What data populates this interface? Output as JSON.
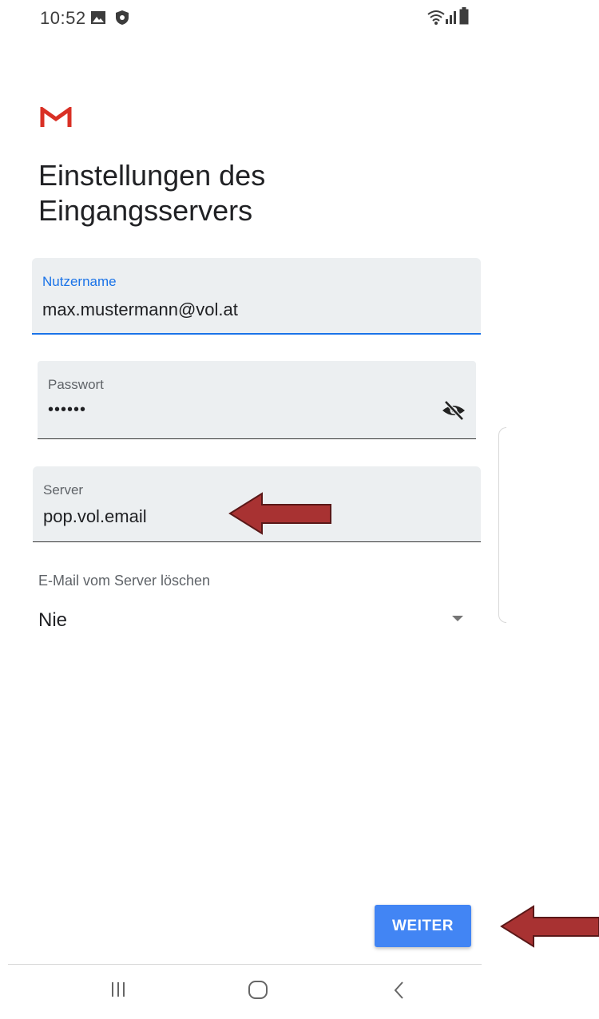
{
  "status_bar": {
    "time": "10:52",
    "icons": [
      "gallery-icon",
      "shield-icon",
      "wifi-icon",
      "signal-icon",
      "battery-icon"
    ]
  },
  "app": {
    "logo": "gmail-logo",
    "brand_color": "#d93025"
  },
  "page": {
    "title": "Einstellungen des Eingangsservers"
  },
  "form": {
    "username": {
      "label": "Nutzername",
      "value": "max.mustermann@vol.at"
    },
    "password": {
      "label": "Passwort",
      "value": "••••••",
      "toggle_icon": "eye-off-icon"
    },
    "server": {
      "label": "Server",
      "value": "pop.vol.email"
    },
    "delete_from_server": {
      "label": "E-Mail vom Server löschen",
      "selected": "Nie"
    }
  },
  "actions": {
    "next_label": "WEITER"
  },
  "colors": {
    "accent": "#1a73e8",
    "button": "#4285f4",
    "field_bg": "#eceff1",
    "arrow": "#a83232"
  },
  "nav_bar": {
    "icons": [
      "recent-apps-icon",
      "home-icon",
      "back-icon"
    ]
  }
}
